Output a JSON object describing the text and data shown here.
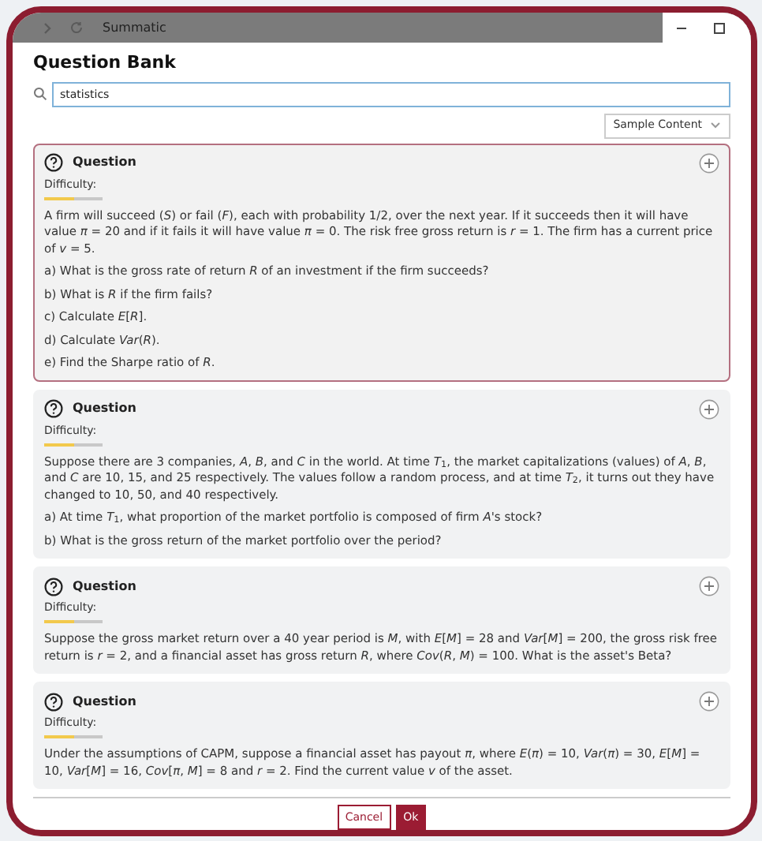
{
  "window": {
    "title": "Summatic"
  },
  "heading": "Question Bank",
  "search": {
    "value": "statistics"
  },
  "filter": {
    "label": "Sample Content"
  },
  "questions": [
    {
      "title": "Question",
      "selected": true,
      "difficulty_label": "Difficulty:",
      "level": 0.5,
      "body": "A firm will succeed (*S*) or fail (*F*), each with probability 1/2, over the next year. If it succeeds then it will have value *π* = 20 and if it fails it will have value *π* = 0. The risk free gross return is *r* = 1. The firm has a current price of *v* = 5.",
      "parts": [
        "a) What is the gross rate of return *R* of an investment if the firm succeeds?",
        "b) What is *R* if the firm fails?",
        "c) Calculate *E*[*R*].",
        "d) Calculate *Var*(*R*).",
        "e) Find the Sharpe ratio of *R*."
      ]
    },
    {
      "title": "Question",
      "selected": false,
      "difficulty_label": "Difficulty:",
      "level": 0.5,
      "body": "Suppose there are 3 companies, *A*, *B*, and *C* in the world. At time *T*$_{1}$, the market capitalizations (values) of *A*, *B*, and *C* are 10, 15, and 25 respectively. The values follow a random process, and at time *T*$_{2}$, it turns out they have changed to 10, 50, and 40 respectively.",
      "parts": [
        "a) At time *T*$_{1}$, what proportion of the market portfolio is composed of firm *A*'s stock?",
        "b) What is the gross return of the market portfolio over the period?"
      ]
    },
    {
      "title": "Question",
      "selected": false,
      "difficulty_label": "Difficulty:",
      "level": 0.5,
      "body": "Suppose the gross market return over a 40 year period is *M*, with *E*[*M*] = 28 and *Var*[*M*] = 200, the gross risk free return is *r* = 2, and a financial asset has gross return *R*, where *Cov*(*R*, *M*) = 100. What is the asset's Beta?"
    },
    {
      "title": "Question",
      "selected": false,
      "difficulty_label": "Difficulty:",
      "level": 0.5,
      "body": "Under the assumptions of CAPM, suppose a financial asset has payout *π*, where *E*(*π*) = 10, *Var*(*π*) = 30, *E*[*M*] = 10, *Var*[*M*] = 16, *Cov*[*π*, *M*] = 8 and *r* = 2. Find the current value *v* of the asset."
    }
  ],
  "buttons": {
    "cancel": "Cancel",
    "ok": "Ok"
  }
}
